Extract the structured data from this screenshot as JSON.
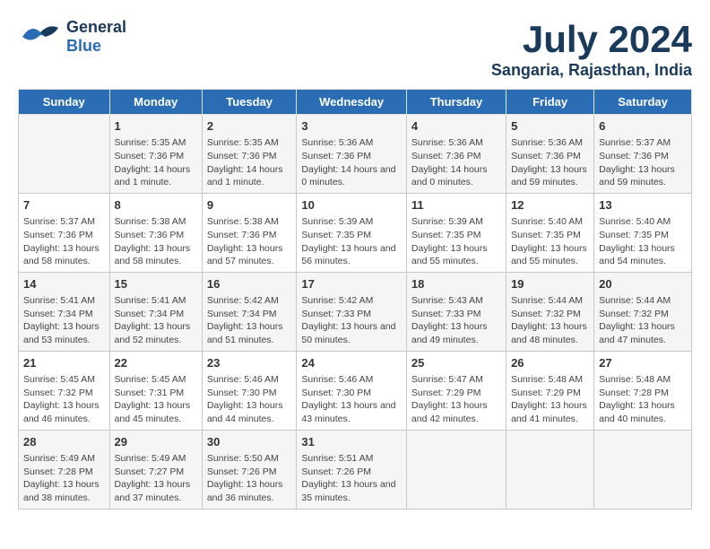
{
  "header": {
    "logo_general": "General",
    "logo_blue": "Blue",
    "main_title": "July 2024",
    "subtitle": "Sangaria, Rajasthan, India"
  },
  "columns": [
    "Sunday",
    "Monday",
    "Tuesday",
    "Wednesday",
    "Thursday",
    "Friday",
    "Saturday"
  ],
  "weeks": [
    [
      {
        "day": "",
        "content": ""
      },
      {
        "day": "1",
        "content": "Sunrise: 5:35 AM\nSunset: 7:36 PM\nDaylight: 14 hours\nand 1 minute."
      },
      {
        "day": "2",
        "content": "Sunrise: 5:35 AM\nSunset: 7:36 PM\nDaylight: 14 hours\nand 1 minute."
      },
      {
        "day": "3",
        "content": "Sunrise: 5:36 AM\nSunset: 7:36 PM\nDaylight: 14 hours\nand 0 minutes."
      },
      {
        "day": "4",
        "content": "Sunrise: 5:36 AM\nSunset: 7:36 PM\nDaylight: 14 hours\nand 0 minutes."
      },
      {
        "day": "5",
        "content": "Sunrise: 5:36 AM\nSunset: 7:36 PM\nDaylight: 13 hours\nand 59 minutes."
      },
      {
        "day": "6",
        "content": "Sunrise: 5:37 AM\nSunset: 7:36 PM\nDaylight: 13 hours\nand 59 minutes."
      }
    ],
    [
      {
        "day": "7",
        "content": "Sunrise: 5:37 AM\nSunset: 7:36 PM\nDaylight: 13 hours\nand 58 minutes."
      },
      {
        "day": "8",
        "content": "Sunrise: 5:38 AM\nSunset: 7:36 PM\nDaylight: 13 hours\nand 58 minutes."
      },
      {
        "day": "9",
        "content": "Sunrise: 5:38 AM\nSunset: 7:36 PM\nDaylight: 13 hours\nand 57 minutes."
      },
      {
        "day": "10",
        "content": "Sunrise: 5:39 AM\nSunset: 7:35 PM\nDaylight: 13 hours\nand 56 minutes."
      },
      {
        "day": "11",
        "content": "Sunrise: 5:39 AM\nSunset: 7:35 PM\nDaylight: 13 hours\nand 55 minutes."
      },
      {
        "day": "12",
        "content": "Sunrise: 5:40 AM\nSunset: 7:35 PM\nDaylight: 13 hours\nand 55 minutes."
      },
      {
        "day": "13",
        "content": "Sunrise: 5:40 AM\nSunset: 7:35 PM\nDaylight: 13 hours\nand 54 minutes."
      }
    ],
    [
      {
        "day": "14",
        "content": "Sunrise: 5:41 AM\nSunset: 7:34 PM\nDaylight: 13 hours\nand 53 minutes."
      },
      {
        "day": "15",
        "content": "Sunrise: 5:41 AM\nSunset: 7:34 PM\nDaylight: 13 hours\nand 52 minutes."
      },
      {
        "day": "16",
        "content": "Sunrise: 5:42 AM\nSunset: 7:34 PM\nDaylight: 13 hours\nand 51 minutes."
      },
      {
        "day": "17",
        "content": "Sunrise: 5:42 AM\nSunset: 7:33 PM\nDaylight: 13 hours\nand 50 minutes."
      },
      {
        "day": "18",
        "content": "Sunrise: 5:43 AM\nSunset: 7:33 PM\nDaylight: 13 hours\nand 49 minutes."
      },
      {
        "day": "19",
        "content": "Sunrise: 5:44 AM\nSunset: 7:32 PM\nDaylight: 13 hours\nand 48 minutes."
      },
      {
        "day": "20",
        "content": "Sunrise: 5:44 AM\nSunset: 7:32 PM\nDaylight: 13 hours\nand 47 minutes."
      }
    ],
    [
      {
        "day": "21",
        "content": "Sunrise: 5:45 AM\nSunset: 7:32 PM\nDaylight: 13 hours\nand 46 minutes."
      },
      {
        "day": "22",
        "content": "Sunrise: 5:45 AM\nSunset: 7:31 PM\nDaylight: 13 hours\nand 45 minutes."
      },
      {
        "day": "23",
        "content": "Sunrise: 5:46 AM\nSunset: 7:30 PM\nDaylight: 13 hours\nand 44 minutes."
      },
      {
        "day": "24",
        "content": "Sunrise: 5:46 AM\nSunset: 7:30 PM\nDaylight: 13 hours\nand 43 minutes."
      },
      {
        "day": "25",
        "content": "Sunrise: 5:47 AM\nSunset: 7:29 PM\nDaylight: 13 hours\nand 42 minutes."
      },
      {
        "day": "26",
        "content": "Sunrise: 5:48 AM\nSunset: 7:29 PM\nDaylight: 13 hours\nand 41 minutes."
      },
      {
        "day": "27",
        "content": "Sunrise: 5:48 AM\nSunset: 7:28 PM\nDaylight: 13 hours\nand 40 minutes."
      }
    ],
    [
      {
        "day": "28",
        "content": "Sunrise: 5:49 AM\nSunset: 7:28 PM\nDaylight: 13 hours\nand 38 minutes."
      },
      {
        "day": "29",
        "content": "Sunrise: 5:49 AM\nSunset: 7:27 PM\nDaylight: 13 hours\nand 37 minutes."
      },
      {
        "day": "30",
        "content": "Sunrise: 5:50 AM\nSunset: 7:26 PM\nDaylight: 13 hours\nand 36 minutes."
      },
      {
        "day": "31",
        "content": "Sunrise: 5:51 AM\nSunset: 7:26 PM\nDaylight: 13 hours\nand 35 minutes."
      },
      {
        "day": "",
        "content": ""
      },
      {
        "day": "",
        "content": ""
      },
      {
        "day": "",
        "content": ""
      }
    ]
  ]
}
